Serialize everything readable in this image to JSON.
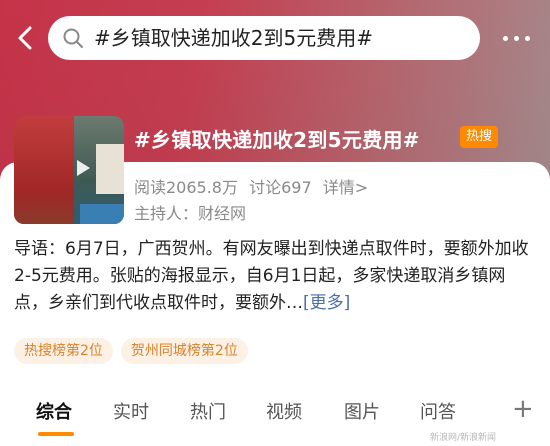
{
  "search": {
    "query": "#乡镇取快递加收2到5元费用#"
  },
  "topic": {
    "title": "#乡镇取快递加收2到5元费用#",
    "badge": "热搜",
    "reads": "阅读2065.8万",
    "discussions": "讨论697",
    "details_link": "详情>",
    "host": "主持人：财经网",
    "summary": "导语：6月7日，广西贺州。有网友曝出到快递点取件时，要额外加收2-5元费用。张贴的海报显示，自6月1日起，多家快递取消乡镇网点，乡亲们到代收点取件时，要额外…",
    "summary_more": "[更多]"
  },
  "tags": [
    "热搜榜第2位",
    "贺州同城榜第2位"
  ],
  "tabs": [
    "综合",
    "实时",
    "热门",
    "视频",
    "图片",
    "问答"
  ],
  "active_tab": "综合",
  "plus_label": "+",
  "watermark": "新浪网/新浪新闻",
  "colors": {
    "accent": "#ff8a00",
    "tag_bg": "#fdf1e6",
    "tag_text": "#d9822b",
    "link": "#4a6ea8"
  },
  "icons": {
    "back": "chevron-left-icon",
    "search": "search-icon",
    "more": "more-dots-icon",
    "play": "play-icon"
  }
}
